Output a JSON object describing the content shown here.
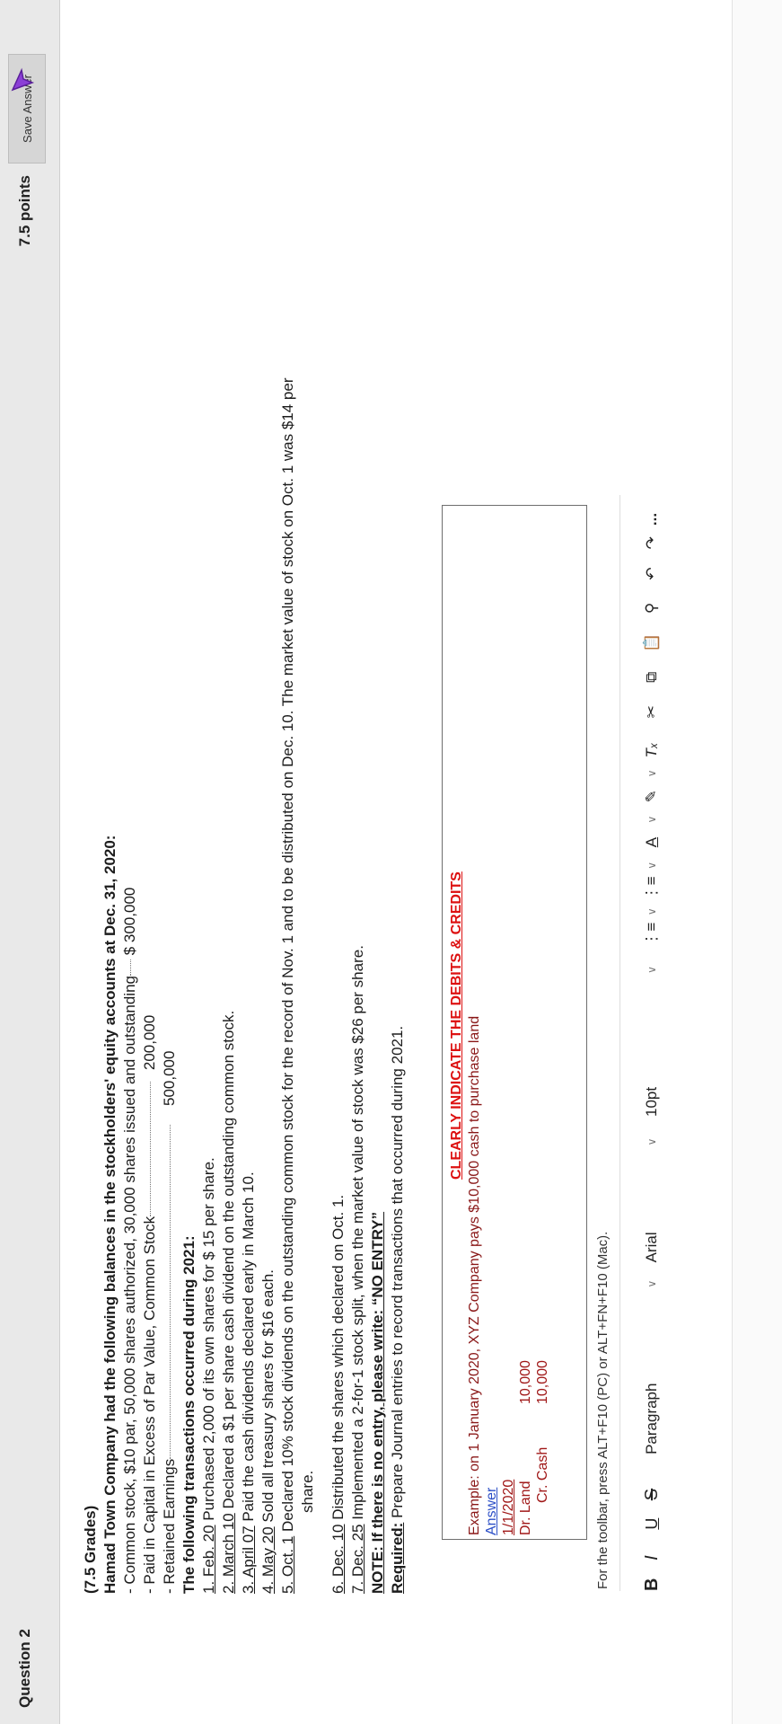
{
  "header": {
    "title": "Question 2",
    "points": "7.5 points",
    "save_label": "Save Answer"
  },
  "question": {
    "grades": "(7.5 Grades)",
    "intro": "Hamad Town Company had the following balances in the stockholders' equity accounts at Dec. 31, 2020:",
    "balances": [
      {
        "label": "- Common stock, $10 par, 50,000 shares authorized, 30,000 shares issued and outstanding",
        "amount": "$ 300,000"
      },
      {
        "label": "- Paid in Capital in Excess of Par Value, Common Stock",
        "amount": "200,000"
      },
      {
        "label": "- Retained Earnings",
        "amount": "500,000"
      }
    ],
    "transactions_heading": "The following transactions occurred during 2021:",
    "transactions": [
      {
        "date": "1. Feb. 20",
        "text": " Purchased 2,000 of its own shares for $ 15 per share."
      },
      {
        "date": "2. March 10",
        "text": " Declared a $1 per share cash dividend on the outstanding common stock."
      },
      {
        "date": "3. April 07",
        "text": " Paid the cash dividends declared early in March 10."
      },
      {
        "date": "4. May 20",
        "text": " Sold all treasury shares for $16 each."
      },
      {
        "date": "5. Oct. 1",
        "text": " Declared 10% stock dividends on the outstanding common stock for the record of Nov. 1 and to be distributed on Dec. 10. The market value of stock on Oct. 1 was $14 per",
        "cont": "share."
      },
      {
        "date": "6. Dec. 10",
        "text": " Distributed the shares which declared on Oct. 1."
      },
      {
        "date": "7. Dec. 25",
        "text": " Implemented a 2-for-1 stock split, when the market value of stock was $26 per share."
      }
    ],
    "note": "NOTE: If there is no entry, please write: “NO ENTRY”",
    "required_label": "Required:",
    "required_text": " Prepare Journal entries to record transactions that occurred during 2021."
  },
  "answer": {
    "emphasis": "CLEARLY INDICATE THE DEBITS & CREDITS",
    "example": "Example: on 1 January 2020, XYZ Company pays $10,000 cash to purchase land",
    "answer_label": "Answer",
    "date": "1/1/2020",
    "debit_account": "Dr. Land",
    "debit_amount": "10,000",
    "credit_account": "Cr. Cash",
    "credit_amount": "10,000"
  },
  "toolbar": {
    "hint": "For the toolbar, press ALT+F10 (PC) or ALT+FN+F10 (Mac).",
    "bold": "B",
    "italic": "I",
    "underline": "U",
    "strike": "S",
    "paragraph": "Paragraph",
    "font": "Arial",
    "size": "10pt",
    "more": "..."
  }
}
